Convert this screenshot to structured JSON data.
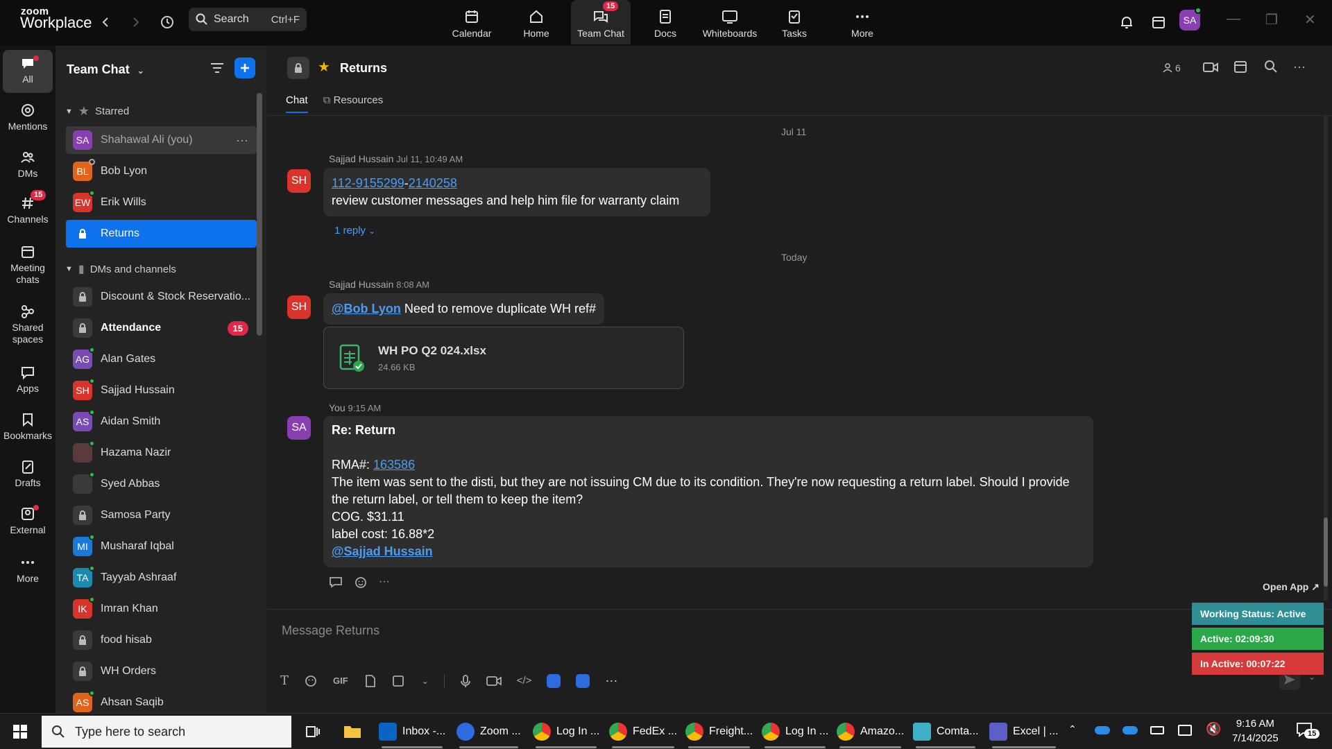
{
  "titlebar": {
    "logo_top": "zoom",
    "logo_bottom": "Workplace",
    "search_label": "Search",
    "search_shortcut": "Ctrl+F",
    "nav": [
      {
        "label": "Calendar"
      },
      {
        "label": "Home"
      },
      {
        "label": "Team Chat",
        "badge": "15"
      },
      {
        "label": "Docs"
      },
      {
        "label": "Whiteboards"
      },
      {
        "label": "Tasks"
      },
      {
        "label": "More"
      }
    ],
    "user_initials": "SA"
  },
  "rail": [
    {
      "label": "All"
    },
    {
      "label": "Mentions"
    },
    {
      "label": "DMs"
    },
    {
      "label": "Channels",
      "badge": "15"
    },
    {
      "label": "Meeting chats"
    },
    {
      "label": "Shared spaces"
    },
    {
      "label": "Apps"
    },
    {
      "label": "Bookmarks"
    },
    {
      "label": "Drafts"
    },
    {
      "label": "External"
    },
    {
      "label": "More"
    }
  ],
  "panel": {
    "title": "Team Chat",
    "starred_label": "Starred",
    "starred": [
      {
        "initials": "SA",
        "name": "Shahawal Ali (you)",
        "color": "#8a3fb0"
      },
      {
        "initials": "BL",
        "name": "Bob Lyon",
        "color": "#e0641a"
      },
      {
        "initials": "EW",
        "name": "Erik Wills",
        "color": "#d9342b"
      },
      {
        "name": "Returns"
      }
    ],
    "dms_label": "DMs and channels",
    "dms": [
      {
        "name": "Discount & Stock Reservatio..."
      },
      {
        "name": "Attendance",
        "count": "15"
      },
      {
        "initials": "AG",
        "name": "Alan Gates",
        "color": "#7b4bb5"
      },
      {
        "initials": "SH",
        "name": "Sajjad Hussain",
        "color": "#d9342b"
      },
      {
        "initials": "AS",
        "name": "Aidan Smith",
        "color": "#7b4bb5"
      },
      {
        "initials": "",
        "name": "Hazama Nazir",
        "color": "#5a3a3a"
      },
      {
        "initials": "",
        "name": "Syed Abbas",
        "color": "#3a3a3a"
      },
      {
        "name": "Samosa Party"
      },
      {
        "initials": "MI",
        "name": "Musharaf Iqbal",
        "color": "#1a7ad9"
      },
      {
        "initials": "TA",
        "name": "Tayyab Ashraaf",
        "color": "#1a8ab0"
      },
      {
        "initials": "IK",
        "name": "Imran Khan",
        "color": "#d9342b"
      },
      {
        "name": "food hisab"
      },
      {
        "name": "WH Orders"
      },
      {
        "initials": "AS",
        "name": "Ahsan Saqib",
        "color": "#e0641a"
      }
    ]
  },
  "channel": {
    "title": "Returns",
    "member_count": "6",
    "tabs": [
      "Chat",
      "Resources"
    ],
    "date1": "Jul 11",
    "date2": "Today",
    "msg1": {
      "avatar": "SH",
      "sender": "Sajjad Hussain",
      "time": "Jul 11, 10:49 AM",
      "link_a": "112-9155299",
      "dash": "-",
      "link_b": "2140258",
      "text": "review customer messages and help him file for warranty claim",
      "replies": "1 reply"
    },
    "msg2": {
      "avatar": "SH",
      "sender": "Sajjad Hussain",
      "time": "8:08 AM",
      "mention": "@Bob Lyon",
      "text": " Need to remove duplicate WH ref#",
      "file_name": "WH PO Q2 024.xlsx",
      "file_size": "24.66 KB"
    },
    "msg3": {
      "avatar": "SA",
      "sender": "You",
      "time": "9:15 AM",
      "subject": "Re: Return",
      "rma_label": "RMA#: ",
      "rma_link": "163586",
      "body": "The item was sent to the disti, but they are not issuing CM due to its condition. They're now requesting a return label. Should I provide the return label, or tell them to keep the item?",
      "cog": "COG. $31.11",
      "label_cost": "label cost: 16.88*2",
      "mention": "@Sajjad Hussain"
    },
    "composer_placeholder": "Message Returns",
    "gif_label": "GIF"
  },
  "status_widget": {
    "open_app": "Open App ↗",
    "working": "Working Status: Active",
    "active": "Active: 02:09:30",
    "inactive": "In Active: 00:07:22",
    "colors": {
      "working": "#2f8f94",
      "active": "#2aa84a",
      "inactive": "#d63a3a"
    }
  },
  "taskbar": {
    "search_placeholder": "Type here to search",
    "apps": [
      "Inbox -...",
      "Zoom ...",
      "Log In ...",
      "FedEx ...",
      "Freight...",
      "Log In ...",
      "Amazo...",
      "Comta...",
      "Excel | ..."
    ],
    "time": "9:16 AM",
    "date": "7/14/2025",
    "notif_count": "15"
  }
}
